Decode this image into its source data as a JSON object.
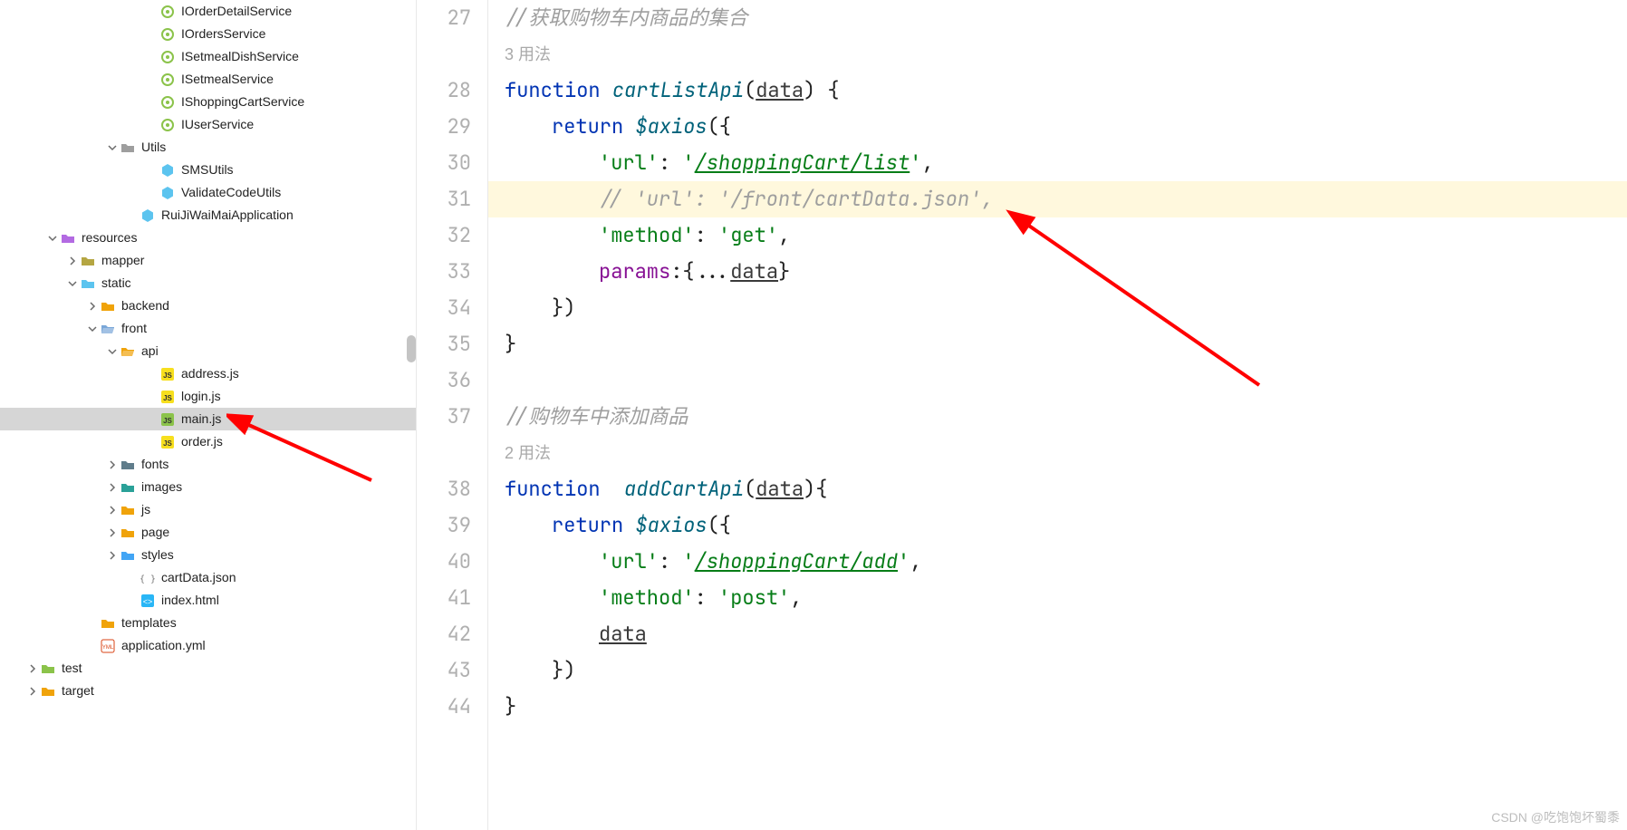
{
  "tree": {
    "rows": [
      {
        "indent": 160,
        "chev": "",
        "iconColor": "#8bc34a",
        "iconType": "interface",
        "label": "IOrderDetailService"
      },
      {
        "indent": 160,
        "chev": "",
        "iconColor": "#8bc34a",
        "iconType": "interface",
        "label": "IOrdersService"
      },
      {
        "indent": 160,
        "chev": "",
        "iconColor": "#8bc34a",
        "iconType": "interface",
        "label": "ISetmealDishService"
      },
      {
        "indent": 160,
        "chev": "",
        "iconColor": "#8bc34a",
        "iconType": "interface",
        "label": "ISetmealService"
      },
      {
        "indent": 160,
        "chev": "",
        "iconColor": "#8bc34a",
        "iconType": "interface",
        "label": "IShoppingCartService"
      },
      {
        "indent": 160,
        "chev": "",
        "iconColor": "#8bc34a",
        "iconType": "interface",
        "label": "IUserService"
      },
      {
        "indent": 116,
        "chev": "down",
        "iconColor": "#9e9e9e",
        "iconType": "folder",
        "label": "Utils"
      },
      {
        "indent": 160,
        "chev": "",
        "iconColor": "#5cc4ef",
        "iconType": "hex",
        "label": "SMSUtils"
      },
      {
        "indent": 160,
        "chev": "",
        "iconColor": "#5cc4ef",
        "iconType": "hex",
        "label": "ValidateCodeUtils"
      },
      {
        "indent": 138,
        "chev": "",
        "iconColor": "#5cc4ef",
        "iconType": "hex",
        "label": "RuiJiWaiMaiApplication"
      },
      {
        "indent": 50,
        "chev": "down",
        "iconColor": "#b36ae2",
        "iconType": "folder",
        "label": "resources"
      },
      {
        "indent": 72,
        "chev": "right",
        "iconColor": "#b5a642",
        "iconType": "folder",
        "label": "mapper"
      },
      {
        "indent": 72,
        "chev": "down",
        "iconColor": "#5cc4ef",
        "iconType": "folder",
        "label": "static"
      },
      {
        "indent": 94,
        "chev": "right",
        "iconColor": "#f0a30a",
        "iconType": "folder",
        "label": "backend"
      },
      {
        "indent": 94,
        "chev": "down",
        "iconColor": "#7aa7d8",
        "iconType": "folder-open",
        "label": "front"
      },
      {
        "indent": 116,
        "chev": "down",
        "iconColor": "#f0a30a",
        "iconType": "folder-open",
        "label": "api"
      },
      {
        "indent": 160,
        "chev": "",
        "iconColor": "#f7df1e",
        "iconType": "js",
        "label": "address.js"
      },
      {
        "indent": 160,
        "chev": "",
        "iconColor": "#f7df1e",
        "iconType": "js",
        "label": "login.js"
      },
      {
        "indent": 160,
        "chev": "",
        "iconColor": "#8bc34a",
        "iconType": "js",
        "label": "main.js",
        "selected": true
      },
      {
        "indent": 160,
        "chev": "",
        "iconColor": "#f7df1e",
        "iconType": "js",
        "label": "order.js"
      },
      {
        "indent": 116,
        "chev": "right",
        "iconColor": "#607d8b",
        "iconType": "folder",
        "label": "fonts"
      },
      {
        "indent": 116,
        "chev": "right",
        "iconColor": "#2aa198",
        "iconType": "folder",
        "label": "images"
      },
      {
        "indent": 116,
        "chev": "right",
        "iconColor": "#f0a30a",
        "iconType": "folder",
        "label": "js"
      },
      {
        "indent": 116,
        "chev": "right",
        "iconColor": "#f0a30a",
        "iconType": "folder",
        "label": "page"
      },
      {
        "indent": 116,
        "chev": "right",
        "iconColor": "#42a5f5",
        "iconType": "folder",
        "label": "styles"
      },
      {
        "indent": 138,
        "chev": "",
        "iconColor": "#777",
        "iconType": "json",
        "label": "cartData.json"
      },
      {
        "indent": 138,
        "chev": "",
        "iconColor": "#29b6f6",
        "iconType": "html",
        "label": "index.html"
      },
      {
        "indent": 94,
        "chev": "",
        "iconColor": "#f0a30a",
        "iconType": "folder",
        "label": "templates"
      },
      {
        "indent": 94,
        "chev": "",
        "iconColor": "#d84315",
        "iconType": "yaml",
        "label": "application.yml"
      },
      {
        "indent": 28,
        "chev": "right",
        "iconColor": "#8bc34a",
        "iconType": "folder",
        "label": "test"
      },
      {
        "indent": 28,
        "chev": "right",
        "iconColor": "#f0a30a",
        "iconType": "folder",
        "label": "target"
      }
    ]
  },
  "editor": {
    "usage1": "3 用法",
    "usage2": "2 用法",
    "tokens": {
      "comment1": "//获取购物车内商品的集合",
      "function": "function",
      "fn1": "cartListApi",
      "fn2": "addCartApi",
      "data": "data",
      "return": "return",
      "axios": "$axios",
      "urlKey": "'url'",
      "urlVal1": "/shoppingCart/list",
      "commentUrl": "// 'url': '/front/cartData.json',",
      "methodKey": "'method'",
      "getVal": "'get'",
      "postVal": "'post'",
      "paramsKey": "params",
      "comment2": "//购物车中添加商品",
      "urlVal2": "/shoppingCart/add",
      "dataIdent": "data"
    },
    "line_numbers": [
      "27",
      "",
      "28",
      "29",
      "30",
      "31",
      "32",
      "33",
      "34",
      "35",
      "36",
      "37",
      "",
      "38",
      "39",
      "40",
      "41",
      "42",
      "43",
      "44"
    ]
  },
  "watermark": "CSDN @吃饱饱坏蜀黍"
}
